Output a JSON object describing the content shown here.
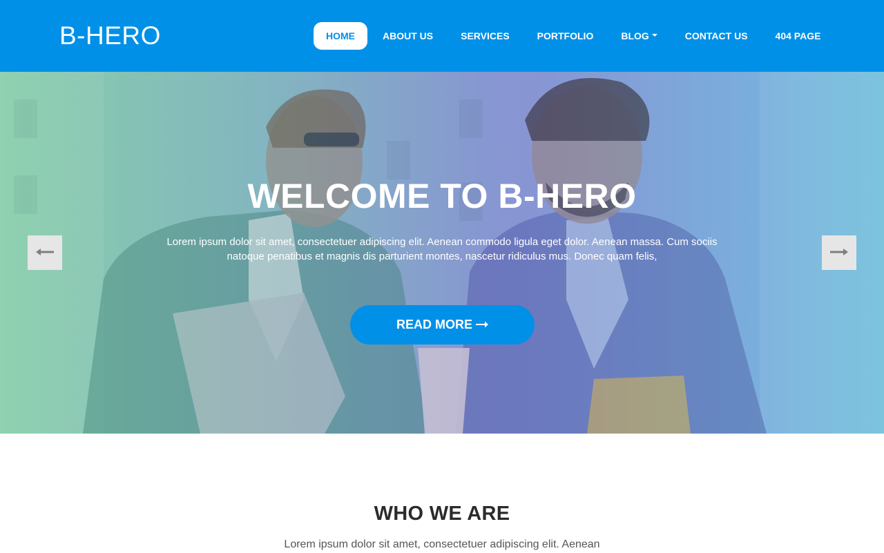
{
  "brand": {
    "name": "B-HERO"
  },
  "nav": {
    "items": [
      {
        "label": "HOME",
        "active": true
      },
      {
        "label": "ABOUT US"
      },
      {
        "label": "SERVICES"
      },
      {
        "label": "PORTFOLIO"
      },
      {
        "label": "BLOG",
        "dropdown": true
      },
      {
        "label": "CONTACT US"
      },
      {
        "label": "404 PAGE"
      }
    ]
  },
  "hero": {
    "title": "WELCOME TO B-HERO",
    "text_line1": "Lorem ipsum dolor sit amet, consectetuer adipiscing elit. Aenean commodo ligula eget dolor. Aenean massa. Cum sociis",
    "text_line2": "natoque penatibus et magnis dis parturient montes, nascetur ridiculus mus. Donec quam felis,",
    "button_label": "READ MORE",
    "button_icon": "arrow-right-icon",
    "prev_icon": "arrow-left-icon",
    "next_icon": "arrow-right-icon"
  },
  "about": {
    "title": "WHO WE ARE",
    "text": "Lorem ipsum dolor sit amet, consectetuer adipiscing elit. Aenean"
  },
  "colors": {
    "primary": "#0190e7",
    "white": "#ffffff",
    "heading": "#2b2b2b",
    "body_text": "#555555",
    "control_bg": "#e6e6e6"
  }
}
